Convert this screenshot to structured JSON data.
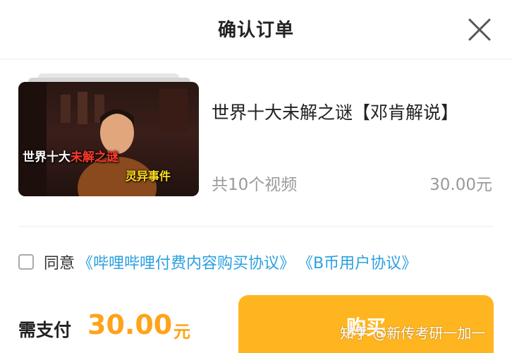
{
  "header": {
    "title": "确认订单",
    "close_icon": "close-icon"
  },
  "item": {
    "title": "世界十大未解之谜【邓肯解说】",
    "video_count": "共10个视频",
    "price": "30.00元",
    "thumbnail": {
      "caption_white": "世界十大",
      "caption_red": "未解之谜",
      "caption_yellow": "灵异事件",
      "red_color": "#ff3a2a",
      "yellow_color": "#ffe01a"
    }
  },
  "agreement": {
    "checked": false,
    "label": "同意",
    "link1": "《哔哩哔哩付费内容购买协议》",
    "link2": "《B币用户协议》",
    "link_color": "#2aa0e0"
  },
  "payment": {
    "label": "需支付",
    "amount": "30.00",
    "unit": "元",
    "accent_color": "#ffa31a"
  },
  "buy_button": {
    "label": "购买",
    "color": "#ffb520"
  },
  "watermark": "知乎 @新传考研一加一"
}
